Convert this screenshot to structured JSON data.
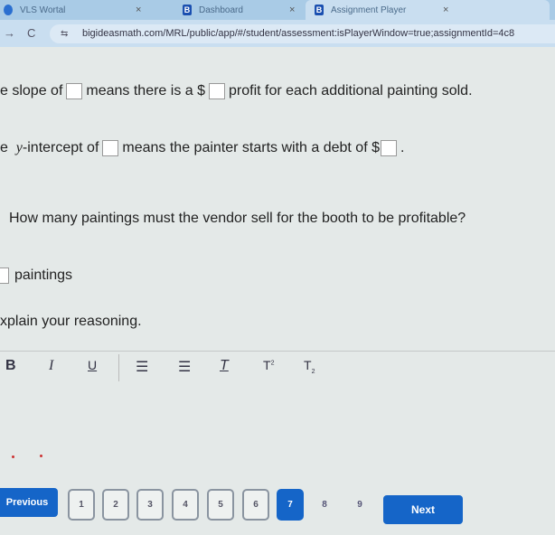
{
  "browser": {
    "tabs": [
      {
        "label": "VLS Wortal",
        "active": false
      },
      {
        "label": "Dashboard",
        "active": false
      },
      {
        "label": "Assignment Player",
        "active": true
      }
    ],
    "url": "bigideasmath.com/MRL/public/app/#/student/assessment:isPlayerWindow=true;assignmentId=4c8"
  },
  "question": {
    "slope_pre": "e slope of",
    "slope_mid": "means there is a $",
    "slope_post": "profit for each additional painting sold.",
    "int_pre": "e",
    "int_var": "y",
    "int_mid": "-intercept of",
    "int_mid2": "means the painter starts with a debt of $",
    "int_post": ".",
    "prompt": "How many paintings must the vendor sell for the booth to be profitable?",
    "answer_unit": "paintings",
    "explain": "xplain your reasoning."
  },
  "toolbar": {
    "bold": "B",
    "italic": "I",
    "underline": "U",
    "bullets": "☰",
    "numbered": "☰",
    "clear_format": "T",
    "superscript": "T",
    "sup": "2",
    "subscript": "T",
    "sub": "2"
  },
  "pager": {
    "previous": "Previous",
    "next": "Next",
    "pages": [
      "1",
      "2",
      "3",
      "4",
      "5",
      "6",
      "7",
      "8",
      "9"
    ],
    "current": "7"
  },
  "colors": {
    "accent": "#1565c8"
  }
}
